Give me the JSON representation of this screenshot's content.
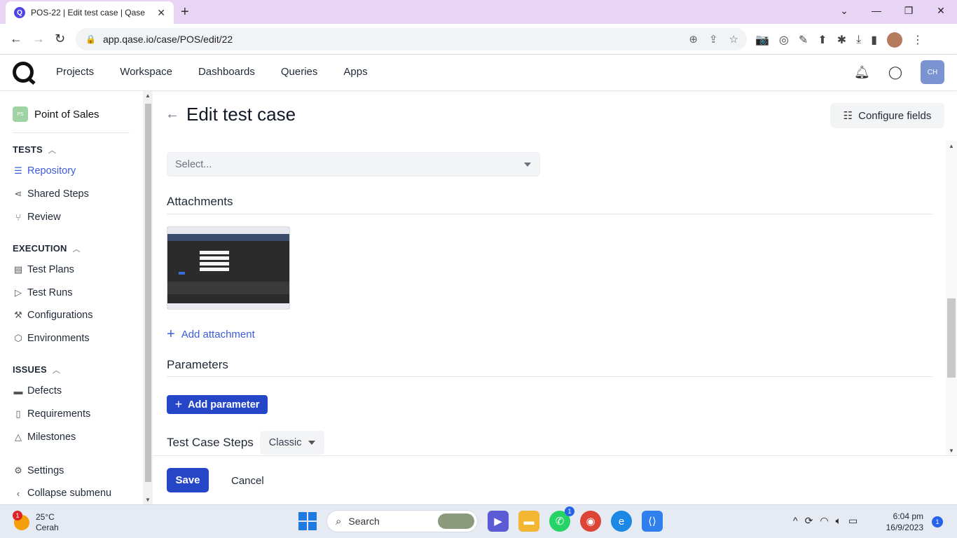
{
  "browser": {
    "tab_title": "POS-22 | Edit test case | Qase",
    "favicon_letter": "Q",
    "url": "app.qase.io/case/POS/edit/22"
  },
  "header": {
    "nav": [
      "Projects",
      "Workspace",
      "Dashboards",
      "Queries",
      "Apps"
    ],
    "avatar_initials": "CH"
  },
  "sidebar": {
    "project_badge": "PS",
    "project_name": "Point of Sales",
    "sections": {
      "tests": "TESTS",
      "execution": "EXECUTION",
      "issues": "ISSUES"
    },
    "items": {
      "repository": "Repository",
      "shared_steps": "Shared Steps",
      "review": "Review",
      "test_plans": "Test Plans",
      "test_runs": "Test Runs",
      "configurations": "Configurations",
      "environments": "Environments",
      "defects": "Defects",
      "requirements": "Requirements",
      "milestones": "Milestones",
      "settings": "Settings",
      "collapse": "Collapse submenu"
    }
  },
  "main": {
    "title": "Edit test case",
    "configure_fields": "Configure fields",
    "select_placeholder": "Select...",
    "attachments_heading": "Attachments",
    "add_attachment": "Add attachment",
    "parameters_heading": "Parameters",
    "add_parameter": "Add parameter",
    "steps_heading": "Test Case Steps",
    "steps_mode": "Classic",
    "save": "Save",
    "cancel": "Cancel"
  },
  "taskbar": {
    "temperature": "25°C",
    "weather": "Cerah",
    "weather_badge": "1",
    "search": "Search",
    "whatsapp_badge": "1",
    "time": "6:04 pm",
    "date": "16/9/2023",
    "notifications": "1"
  },
  "colors": {
    "primary": "#2546c7",
    "link": "#3b5bdb",
    "tabbar": "#e8d5f5"
  }
}
